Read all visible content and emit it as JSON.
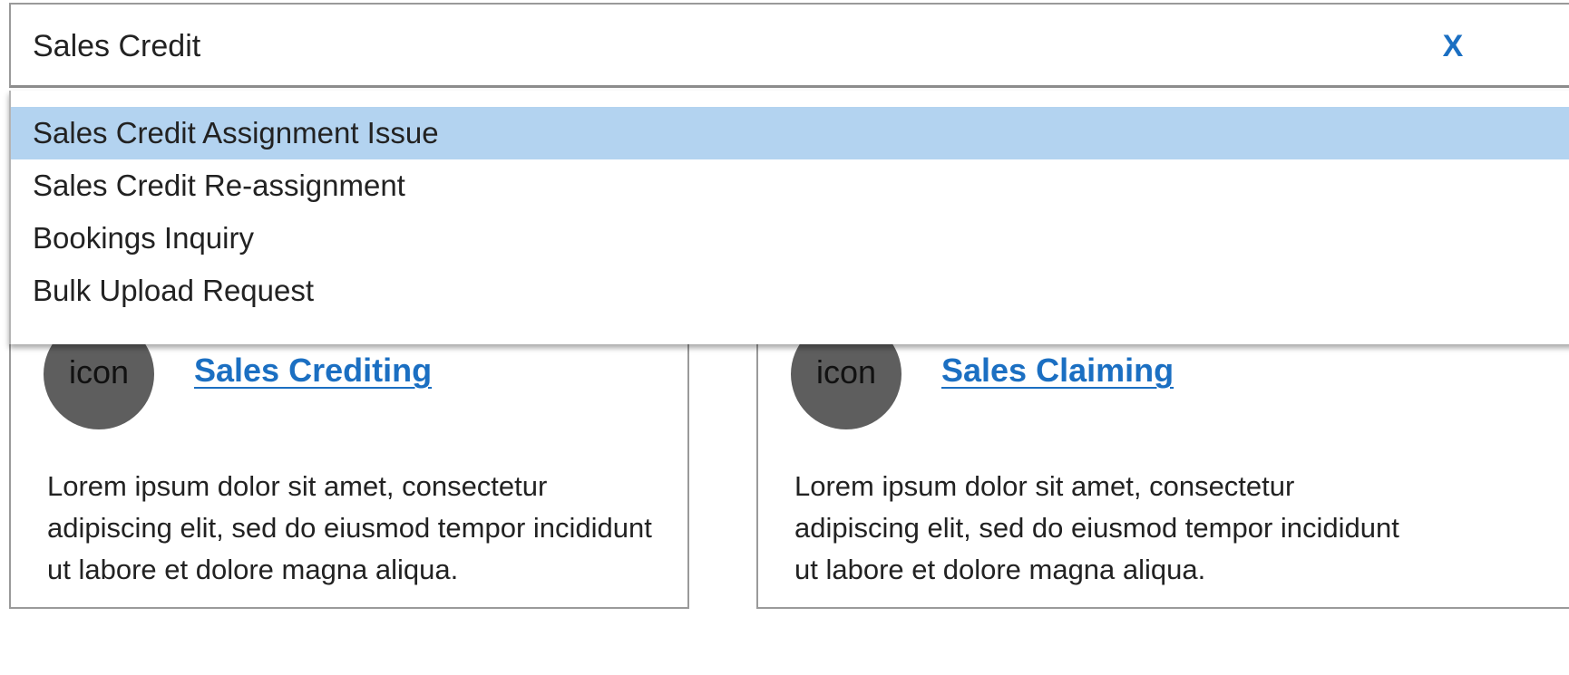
{
  "search": {
    "value": "Sales Credit",
    "clear_label": "X"
  },
  "dropdown": {
    "items": [
      {
        "label": "Sales Credit Assignment Issue",
        "highlighted": true
      },
      {
        "label": "Sales Credit Re-assignment",
        "highlighted": false
      },
      {
        "label": "Bookings Inquiry",
        "highlighted": false
      },
      {
        "label": "Bulk Upload Request",
        "highlighted": false
      }
    ]
  },
  "cards": [
    {
      "icon_label": "icon",
      "title": "Sales Crediting",
      "description": "Lorem ipsum dolor sit amet, consectetur adipiscing elit, sed do eiusmod tempor incididunt ut labore et dolore magna aliqua."
    },
    {
      "icon_label": "icon",
      "title": "Sales Claiming",
      "description": "Lorem ipsum dolor sit amet, consectetur adipiscing elit, sed do eiusmod tempor incididunt ut labore et dolore magna aliqua."
    }
  ],
  "colors": {
    "accent": "#1b6fc2",
    "highlight": "#b3d3f0",
    "icon_circle": "#5e5e5e"
  }
}
